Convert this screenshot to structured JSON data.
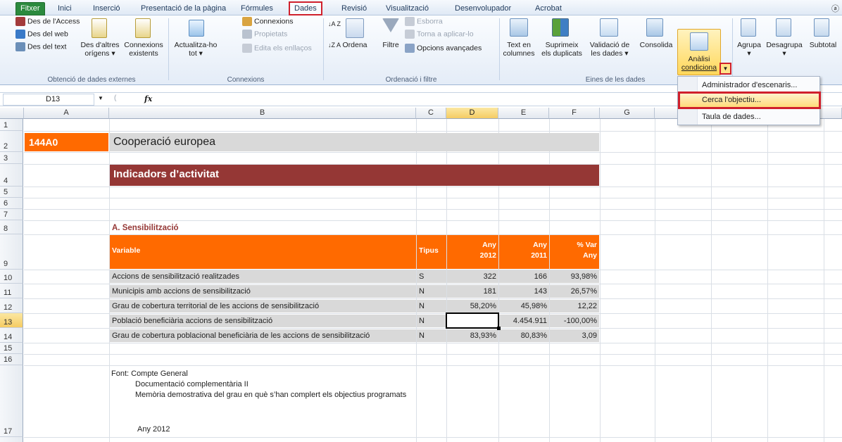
{
  "tabs": [
    "Fitxer",
    "Inici",
    "Inserció",
    "Presentació de la pàgina",
    "Fórmules",
    "Dades",
    "Revisió",
    "Visualització",
    "Desenvolupador",
    "Acrobat"
  ],
  "help_icon": "help-icon",
  "ribbon": {
    "external": {
      "access": "Des de l'Access",
      "web": "Des del web",
      "text": "Des del text",
      "other_1": "Des d'altres",
      "other_2": "orígens ▾",
      "existing_1": "Connexions",
      "existing_2": "existents",
      "group": "Obtenció de dades externes"
    },
    "connections": {
      "refresh_1": "Actualitza-ho",
      "refresh_2": "tot ▾",
      "connections": "Connexions",
      "properties": "Propietats",
      "edit_links": "Edita els enllaços",
      "group": "Connexions"
    },
    "sort": {
      "az": "A Z",
      "za": "Z A",
      "sort": "Ordena",
      "filter": "Filtre",
      "clear": "Esborra",
      "reapply": "Torna a aplicar-lo",
      "advanced": "Opcions avançades",
      "group": "Ordenació i filtre"
    },
    "tools": {
      "text_cols_1": "Text en",
      "text_cols_2": "columnes",
      "remove_dup_1": "Suprimeix",
      "remove_dup_2": "els duplicats",
      "validation_1": "Validació de",
      "validation_2": "les dades ▾",
      "consolidate": "Consolida",
      "whatif_1": "Anàlisi",
      "whatif_2": "condiciona",
      "group": "Eines de les dades"
    },
    "outline": {
      "group_btn": "Agrupa",
      "ungroup_btn": "Desagrupa",
      "subtotal": "Subtotal"
    }
  },
  "formula_bar": {
    "name_box": "D13",
    "fx": "fx",
    "value": ""
  },
  "columns": [
    "A",
    "B",
    "C",
    "D",
    "E",
    "F",
    "G"
  ],
  "rows": [
    "1",
    "2",
    "3",
    "4",
    "5",
    "6",
    "7",
    "8",
    "9",
    "10",
    "11",
    "12",
    "13",
    "14",
    "15",
    "16",
    "17"
  ],
  "sheet": {
    "code": "144A0",
    "title": "Cooperació europea",
    "subtitle": "Indicadors d’activitat",
    "section": "A. Sensibilització",
    "headers": {
      "variable": "Variable",
      "type": "Tipus",
      "any2012_1": "Any",
      "any2012_2": "2012",
      "any2011_1": "Any",
      "any2011_2": "2011",
      "var_1": "% Var",
      "var_2": "Any"
    },
    "table": [
      {
        "variable": "Accions de sensibilització realitzades",
        "type": "S",
        "y2012": "322",
        "y2011": "166",
        "var": "93,98%"
      },
      {
        "variable": "Municipis amb accions de sensibilització",
        "type": "N",
        "y2012": "181",
        "y2011": "143",
        "var": "26,57%"
      },
      {
        "variable": "Grau de cobertura territorial de les accions de sensibilització",
        "type": "N",
        "y2012": "58,20%",
        "y2011": "45,98%",
        "var": "12,22"
      },
      {
        "variable": "Població beneficiària accions de sensibilització",
        "type": "N",
        "y2012": "",
        "y2011": "4.454.911",
        "var": "-100,00%"
      },
      {
        "variable": "Grau de cobertura poblacional beneficiària de les accions de sensibilització",
        "type": "N",
        "y2012": "83,93%",
        "y2011": "80,83%",
        "var": "3,09"
      }
    ],
    "notes": {
      "font": "Font:  Compte General",
      "doc": "Documentació complementària II",
      "memoria": "Memòria demostrativa del grau en què s’han complert els objectius programats",
      "year": "Any 2012"
    }
  },
  "whatif_menu": [
    "Administrador d'escenaris...",
    "Cerca l'objectiu...",
    "Taula de dades..."
  ],
  "colors": {
    "orange": "#ff6a00",
    "maroon": "#953735",
    "grey": "#d9d9d9",
    "highlight": "#d0202c"
  }
}
